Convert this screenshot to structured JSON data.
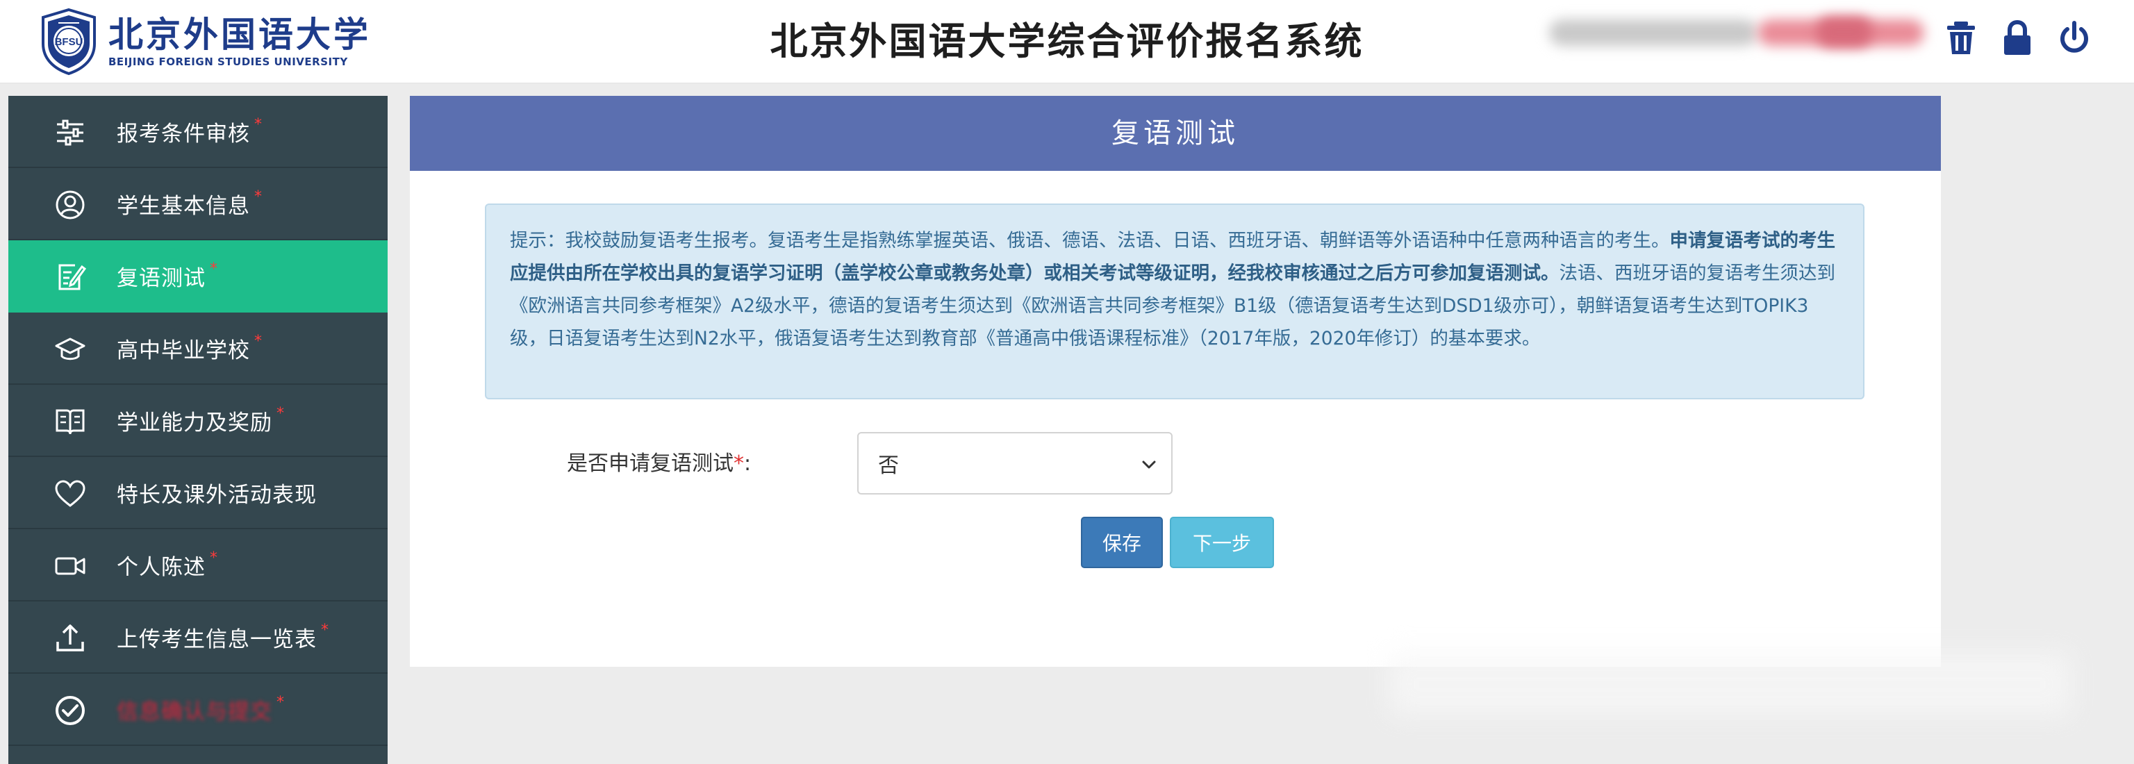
{
  "header": {
    "logo_cn": "北京外国语大学",
    "logo_en": "BEIJING FOREIGN STUDIES UNIVERSITY",
    "emblem_text": "BFSU",
    "title": "北京外国语大学综合评价报名系统",
    "icons": [
      "trash-icon",
      "lock-icon",
      "power-icon"
    ]
  },
  "sidebar": {
    "items": [
      {
        "label": "报考条件审核",
        "required": "*",
        "icon": "sliders-icon"
      },
      {
        "label": "学生基本信息",
        "required": "*",
        "icon": "user-circle-icon"
      },
      {
        "label": "复语测试",
        "required": "*",
        "icon": "edit-note-icon",
        "active": true
      },
      {
        "label": "高中毕业学校",
        "required": "*",
        "icon": "graduation-cap-icon"
      },
      {
        "label": "学业能力及奖励",
        "required": "*",
        "icon": "open-book-icon"
      },
      {
        "label": "特长及课外活动表现",
        "icon": "heart-icon"
      },
      {
        "label": "个人陈述",
        "required": "*",
        "icon": "video-camera-icon"
      },
      {
        "label": "上传考生信息一览表",
        "required": "*",
        "icon": "upload-icon"
      },
      {
        "label": "信息确认与提交",
        "required": "*",
        "icon": "check-circle-icon"
      }
    ]
  },
  "main": {
    "card_title": "复语测试",
    "tip": {
      "part1": "提示：我校鼓励复语考生报考。复语考生是指熟练掌握英语、俄语、德语、法语、日语、西班牙语、朝鲜语等外语语种中任意两种语言的考生。",
      "bold": "申请复语考试的考生应提供由所在学校出具的复语学习证明（盖学校公章或教务处章）或相关考试等级证明，经我校审核通过之后方可参加复语测试。",
      "part2": "法语、西班牙语的复语考生须达到《欧洲语言共同参考框架》A2级水平，德语的复语考生须达到《欧洲语言共同参考框架》B1级（德语复语考生达到DSD1级亦可），朝鲜语复语考生达到TOPIK3级，日语复语考生达到N2水平，俄语复语考生达到教育部《普通高中俄语课程标准》（2017年版，2020年修订）的基本要求。"
    },
    "form": {
      "label": "是否申请复语测试",
      "required": "*",
      "colon": ":",
      "selected": "否"
    },
    "buttons": {
      "save": "保存",
      "next": "下一步"
    }
  },
  "colors": {
    "sidebar_bg": "#34474f",
    "sidebar_active": "#1ebd8b",
    "card_header": "#5b6fb0",
    "tip_bg": "#d9eaf5",
    "btn_save": "#3c7ab8",
    "btn_next": "#5bc0de"
  }
}
